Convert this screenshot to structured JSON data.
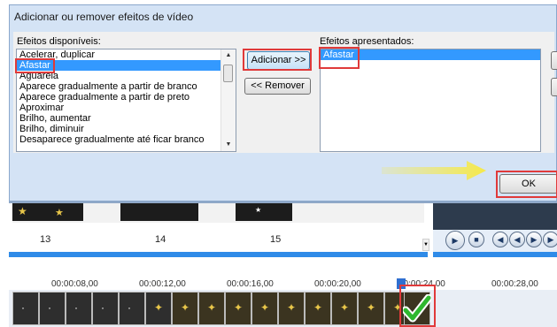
{
  "dialog": {
    "title": "Adicionar ou remover efeitos de vídeo",
    "available_label": "Efeitos disponíveis:",
    "applied_label": "Efeitos apresentados:",
    "available_items": [
      "Acelerar, duplicar",
      "Afastar",
      "Aguarela",
      "Aparece gradualmente a partir de branco",
      "Aparece gradualmente a partir de preto",
      "Aproximar",
      "Brilho, aumentar",
      "Brilho, diminuir",
      "Desaparece gradualmente até ficar branco"
    ],
    "selected_available": "Afastar",
    "applied_items": [
      "Afastar"
    ],
    "add_button": "Adicionar >>",
    "remove_button": "<< Remover",
    "ok_button": "OK"
  },
  "storyboard": {
    "numbers": [
      "13",
      "14",
      "15"
    ]
  },
  "timeline": {
    "ticks": [
      "00:00:08,00",
      "00:00:12,00",
      "00:00:16,00",
      "00:00:20,00",
      "00:00:24,00",
      "00:00:28,00"
    ]
  },
  "colors": {
    "highlight_box": "#e03a3a",
    "arrow": "#f5e94a",
    "selection": "#3399ff",
    "check": "#2fb82f"
  },
  "icons": [
    "scroll-up-arrow",
    "scroll-down-arrow",
    "yellow-arrow",
    "play-icon",
    "stop-icon",
    "rewind-icon",
    "prev-frame-icon",
    "next-frame-icon",
    "forward-icon",
    "check-mark-icon"
  ]
}
